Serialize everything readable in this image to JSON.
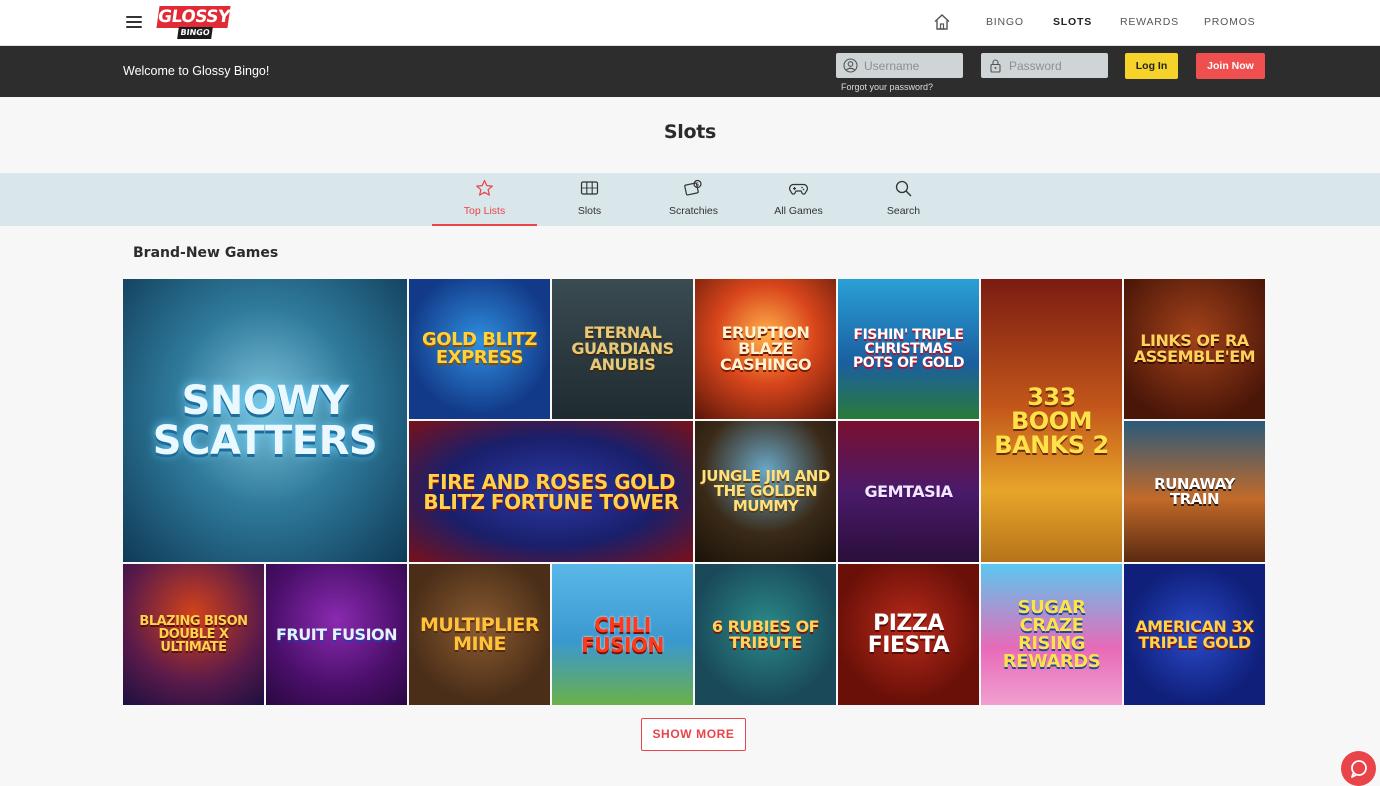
{
  "brand": {
    "logo_main": "GLOSSY",
    "logo_sub": "BINGO"
  },
  "nav": {
    "links": [
      {
        "label": "BINGO",
        "active": false
      },
      {
        "label": "SLOTS",
        "active": true
      },
      {
        "label": "REWARDS",
        "active": false
      },
      {
        "label": "PROMOS",
        "active": false
      }
    ]
  },
  "loginbar": {
    "welcome": "Welcome to Glossy Bingo!",
    "username_placeholder": "Username",
    "password_placeholder": "Password",
    "forgot": "Forgot your password?",
    "login_label": "Log In",
    "join_label": "Join Now"
  },
  "page": {
    "title": "Slots"
  },
  "tabs": [
    {
      "label": "Top Lists",
      "icon": "star-icon",
      "active": true
    },
    {
      "label": "Slots",
      "icon": "slot-machine-icon",
      "active": false
    },
    {
      "label": "Scratchies",
      "icon": "scratch-card-icon",
      "active": false
    },
    {
      "label": "All Games",
      "icon": "gamepad-icon",
      "active": false
    },
    {
      "label": "Search",
      "icon": "search-icon",
      "active": false
    }
  ],
  "section": {
    "title": "Brand-New Games"
  },
  "games": [
    {
      "title": "Snowy Scatters"
    },
    {
      "title": "Gold Blitz Express"
    },
    {
      "title": "Eternal Guardians Anubis"
    },
    {
      "title": "Eruption Blaze Cashingo"
    },
    {
      "title": "Fishin' Triple Christmas Pots of Gold"
    },
    {
      "title": "333 Boom Banks 2"
    },
    {
      "title": "Links of Ra Assemble'em"
    },
    {
      "title": "Fire and Roses Gold Blitz Fortune Tower"
    },
    {
      "title": "Jungle Jim and the Golden Mummy"
    },
    {
      "title": "Gemtasia"
    },
    {
      "title": "Runaway Train"
    },
    {
      "title": "Blazing Bison Double X Ultimate"
    },
    {
      "title": "Fruit Fusion"
    },
    {
      "title": "Multiplier Mine"
    },
    {
      "title": "Chili Fusion"
    },
    {
      "title": "6 Rubies of Tribute"
    },
    {
      "title": "Pizza Fiesta"
    },
    {
      "title": "Sugar Craze Rising Rewards"
    },
    {
      "title": "American 3X Triple Gold"
    }
  ],
  "show_more": "SHOW MORE"
}
